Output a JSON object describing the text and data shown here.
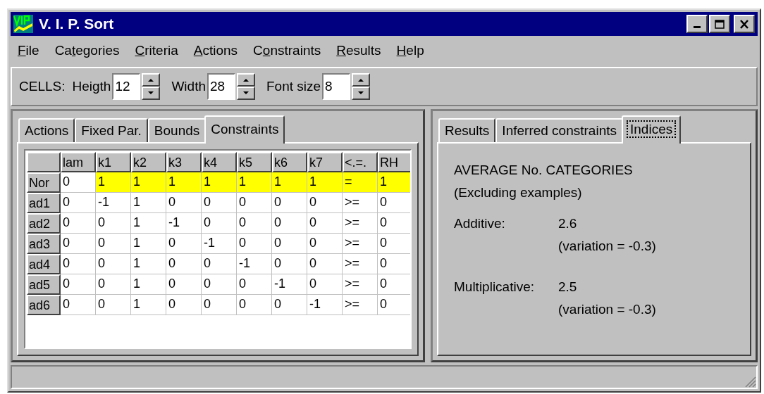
{
  "window": {
    "title": "V. I. P. Sort"
  },
  "menu": [
    {
      "key": "F",
      "post": "ile"
    },
    {
      "pre": "Ca",
      "key": "t",
      "post": "egories"
    },
    {
      "key": "C",
      "post": "riteria"
    },
    {
      "key": "A",
      "post": "ctions"
    },
    {
      "pre": "C",
      "key": "o",
      "post": "nstraints"
    },
    {
      "key": "R",
      "post": "esults"
    },
    {
      "key": "H",
      "post": "elp"
    }
  ],
  "toolbar": {
    "label": "CELLS:",
    "spinners": [
      {
        "label": "Heigth",
        "value": "12"
      },
      {
        "label": "Width",
        "value": "28"
      },
      {
        "label": "Font size",
        "value": "8"
      }
    ]
  },
  "left_tabs": [
    {
      "label": "Actions",
      "selected": false
    },
    {
      "label": "Fixed Par.",
      "selected": false
    },
    {
      "label": "Bounds",
      "selected": false
    },
    {
      "label": "Constraints",
      "selected": true
    }
  ],
  "table": {
    "columns": [
      "lam",
      "k1",
      "k2",
      "k3",
      "k4",
      "k5",
      "k6",
      "k7",
      "<.=.",
      "RH"
    ],
    "rows": [
      {
        "header": "Nor",
        "cells": [
          {
            "text": "0",
            "highlighted": false
          },
          {
            "text": "1",
            "highlighted": true
          },
          {
            "text": "1",
            "highlighted": true
          },
          {
            "text": "1",
            "highlighted": true
          },
          {
            "text": "1",
            "highlighted": true
          },
          {
            "text": "1",
            "highlighted": true
          },
          {
            "text": "1",
            "highlighted": true
          },
          {
            "text": "1",
            "highlighted": true
          },
          {
            "text": "=",
            "highlighted": true
          },
          {
            "text": "1",
            "highlighted": true
          }
        ]
      },
      {
        "header": "ad1",
        "cells": [
          {
            "text": "0",
            "highlighted": false
          },
          {
            "text": "-1",
            "highlighted": false
          },
          {
            "text": "1",
            "highlighted": false
          },
          {
            "text": "0",
            "highlighted": false
          },
          {
            "text": "0",
            "highlighted": false
          },
          {
            "text": "0",
            "highlighted": false
          },
          {
            "text": "0",
            "highlighted": false
          },
          {
            "text": "0",
            "highlighted": false
          },
          {
            "text": ">=",
            "highlighted": false
          },
          {
            "text": "0",
            "highlighted": false
          }
        ]
      },
      {
        "header": "ad2",
        "cells": [
          {
            "text": "0",
            "highlighted": false
          },
          {
            "text": "0",
            "highlighted": false
          },
          {
            "text": "1",
            "highlighted": false
          },
          {
            "text": "-1",
            "highlighted": false
          },
          {
            "text": "0",
            "highlighted": false
          },
          {
            "text": "0",
            "highlighted": false
          },
          {
            "text": "0",
            "highlighted": false
          },
          {
            "text": "0",
            "highlighted": false
          },
          {
            "text": ">=",
            "highlighted": false
          },
          {
            "text": "0",
            "highlighted": false
          }
        ]
      },
      {
        "header": "ad3",
        "cells": [
          {
            "text": "0",
            "highlighted": false
          },
          {
            "text": "0",
            "highlighted": false
          },
          {
            "text": "1",
            "highlighted": false
          },
          {
            "text": "0",
            "highlighted": false
          },
          {
            "text": "-1",
            "highlighted": false
          },
          {
            "text": "0",
            "highlighted": false
          },
          {
            "text": "0",
            "highlighted": false
          },
          {
            "text": "0",
            "highlighted": false
          },
          {
            "text": ">=",
            "highlighted": false
          },
          {
            "text": "0",
            "highlighted": false
          }
        ]
      },
      {
        "header": "ad4",
        "cells": [
          {
            "text": "0",
            "highlighted": false
          },
          {
            "text": "0",
            "highlighted": false
          },
          {
            "text": "1",
            "highlighted": false
          },
          {
            "text": "0",
            "highlighted": false
          },
          {
            "text": "0",
            "highlighted": false
          },
          {
            "text": "-1",
            "highlighted": false
          },
          {
            "text": "0",
            "highlighted": false
          },
          {
            "text": "0",
            "highlighted": false
          },
          {
            "text": ">=",
            "highlighted": false
          },
          {
            "text": "0",
            "highlighted": false
          }
        ]
      },
      {
        "header": "ad5",
        "cells": [
          {
            "text": "0",
            "highlighted": false
          },
          {
            "text": "0",
            "highlighted": false
          },
          {
            "text": "1",
            "highlighted": false
          },
          {
            "text": "0",
            "highlighted": false
          },
          {
            "text": "0",
            "highlighted": false
          },
          {
            "text": "0",
            "highlighted": false
          },
          {
            "text": "-1",
            "highlighted": false
          },
          {
            "text": "0",
            "highlighted": false
          },
          {
            "text": ">=",
            "highlighted": false
          },
          {
            "text": "0",
            "highlighted": false
          }
        ]
      },
      {
        "header": "ad6",
        "cells": [
          {
            "text": "0",
            "highlighted": false
          },
          {
            "text": "0",
            "highlighted": false
          },
          {
            "text": "1",
            "highlighted": false
          },
          {
            "text": "0",
            "highlighted": false
          },
          {
            "text": "0",
            "highlighted": false
          },
          {
            "text": "0",
            "highlighted": false
          },
          {
            "text": "0",
            "highlighted": false
          },
          {
            "text": "-1",
            "highlighted": false
          },
          {
            "text": ">=",
            "highlighted": false
          },
          {
            "text": "0",
            "highlighted": false
          }
        ]
      }
    ]
  },
  "right_tabs": [
    {
      "label": "Results",
      "selected": false
    },
    {
      "label": "Inferred constraints",
      "selected": false
    },
    {
      "label": "Indices",
      "selected": true
    }
  ],
  "indices": {
    "heading": "AVERAGE No. CATEGORIES",
    "subheading": "(Excluding examples)",
    "items": [
      {
        "label": "Additive:",
        "value": "2.6",
        "variation": "(variation = -0.3)"
      },
      {
        "label": "Multiplicative:",
        "value": "2.5",
        "variation": "(variation = -0.3)"
      }
    ]
  }
}
